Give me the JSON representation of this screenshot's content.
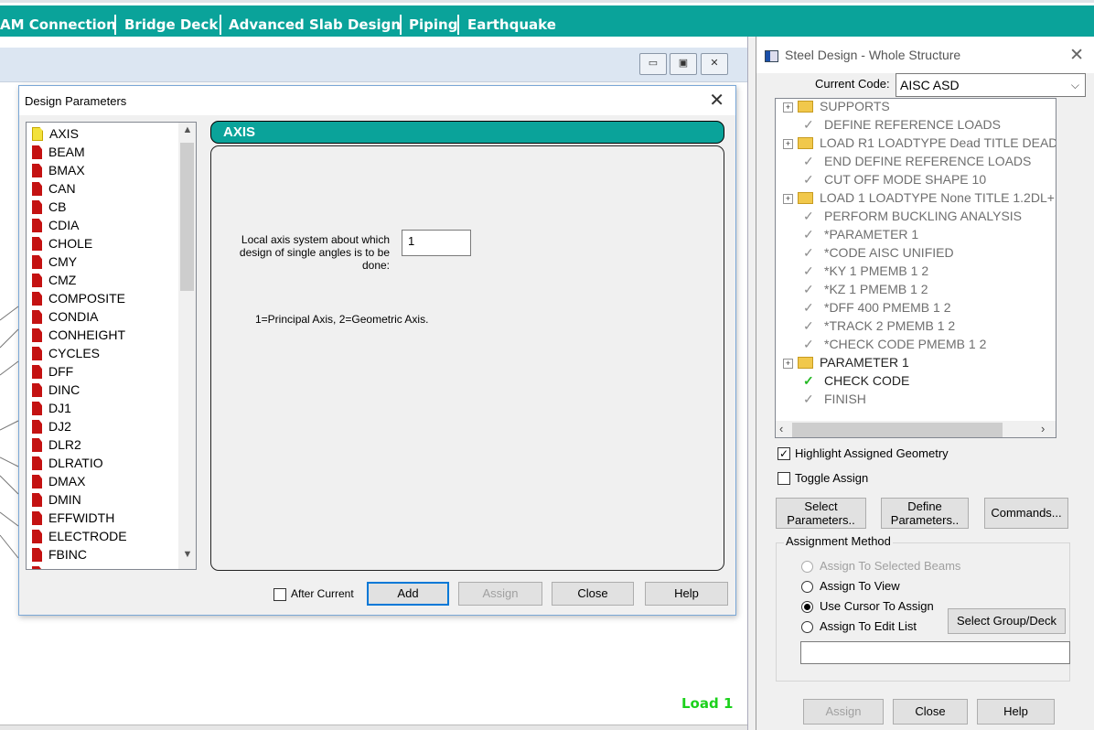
{
  "ribbon": {
    "tabs": [
      {
        "label": "AM Connection",
        "selected": false
      },
      {
        "label": "Bridge Deck",
        "selected": true
      },
      {
        "label": "Advanced Slab Design",
        "selected": false
      },
      {
        "label": "Piping",
        "selected": true
      },
      {
        "label": "Earthquake",
        "selected": false
      }
    ],
    "accent": "#0aa39a"
  },
  "view": {
    "status_text": "Load 1",
    "status_color": "#1bd11b",
    "window_buttons": [
      "minimize-icon",
      "restore-icon",
      "close-icon"
    ]
  },
  "design_params_dialog": {
    "title": "Design Parameters",
    "close_glyph": "✕",
    "params": [
      "AXIS",
      "BEAM",
      "BMAX",
      "CAN",
      "CB",
      "CDIA",
      "CHOLE",
      "CMY",
      "CMZ",
      "COMPOSITE",
      "CONDIA",
      "CONHEIGHT",
      "CYCLES",
      "DFF",
      "DINC",
      "DJ1",
      "DJ2",
      "DLR2",
      "DLRATIO",
      "DMAX",
      "DMIN",
      "EFFWIDTH",
      "ELECTRODE",
      "FBINC"
    ],
    "selected_param": "AXIS",
    "section_header": "AXIS",
    "axis_label": "Local axis system about which design of single angles is to be done:",
    "axis_value": "1",
    "axis_note": "1=Principal Axis, 2=Geometric Axis.",
    "after_current_label": "After Current",
    "after_current_checked": false,
    "buttons": {
      "add": "Add",
      "assign": "Assign",
      "close": "Close",
      "help": "Help"
    }
  },
  "steel_design": {
    "title": "Steel Design - Whole Structure",
    "close_glyph": "✕",
    "current_code_label": "Current Code:",
    "current_code_value": "AISC ASD",
    "tree": [
      {
        "label": "SUPPORTS",
        "kind": "folder",
        "expand": true
      },
      {
        "label": "DEFINE REFERENCE LOADS",
        "kind": "check"
      },
      {
        "label": "LOAD R1 LOADTYPE Dead  TITLE DEAD",
        "kind": "folder",
        "expand": true
      },
      {
        "label": "END DEFINE REFERENCE LOADS",
        "kind": "check"
      },
      {
        "label": "CUT OFF MODE SHAPE 10",
        "kind": "check"
      },
      {
        "label": "LOAD 1 LOADTYPE None  TITLE 1.2DL+",
        "kind": "folder",
        "expand": true
      },
      {
        "label": "PERFORM BUCKLING ANALYSIS",
        "kind": "check"
      },
      {
        "label": "*PARAMETER 1",
        "kind": "check"
      },
      {
        "label": "*CODE AISC UNIFIED",
        "kind": "check"
      },
      {
        "label": "*KY 1 PMEMB 1 2",
        "kind": "check"
      },
      {
        "label": "*KZ 1 PMEMB 1 2",
        "kind": "check"
      },
      {
        "label": "*DFF 400 PMEMB 1 2",
        "kind": "check"
      },
      {
        "label": "*TRACK 2 PMEMB 1 2",
        "kind": "check"
      },
      {
        "label": "*CHECK CODE PMEMB 1 2",
        "kind": "check"
      },
      {
        "label": "PARAMETER 1",
        "kind": "folder",
        "expand": true,
        "dark": true
      },
      {
        "label": "CHECK CODE",
        "kind": "checkgreen",
        "dark": true
      },
      {
        "label": "FINISH",
        "kind": "check"
      }
    ],
    "highlight_label": "Highlight Assigned Geometry",
    "highlight_checked": true,
    "toggle_label": "Toggle Assign",
    "toggle_checked": false,
    "select_params_label": [
      "Select",
      "Parameters.."
    ],
    "define_params_label": [
      "Define",
      "Parameters.."
    ],
    "commands_label": "Commands...",
    "assignment_method_label": "Assignment Method",
    "methods": [
      {
        "label": "Assign To Selected Beams",
        "disabled": true,
        "selected": false
      },
      {
        "label": "Assign To View",
        "disabled": false,
        "selected": false
      },
      {
        "label": "Use Cursor To Assign",
        "disabled": false,
        "selected": true
      },
      {
        "label": "Assign To Edit List",
        "disabled": false,
        "selected": false
      }
    ],
    "select_group_label": "Select Group/Deck",
    "edit_list_value": "",
    "bottom_buttons": {
      "assign": "Assign",
      "close": "Close",
      "help": "Help"
    }
  }
}
